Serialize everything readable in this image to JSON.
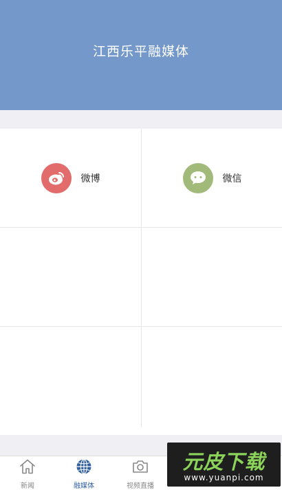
{
  "header": {
    "title": "江西乐平融媒体"
  },
  "share": {
    "items": [
      {
        "label": "微博",
        "icon": "weibo-icon",
        "color": "#e26b6b"
      },
      {
        "label": "微信",
        "icon": "wechat-icon",
        "color": "#a1ba7a"
      }
    ]
  },
  "tabbar": {
    "active_color": "#2f5f9e",
    "items": [
      {
        "label": "新闻",
        "icon": "home-icon"
      },
      {
        "label": "融媒体",
        "icon": "globe-icon",
        "active": true
      },
      {
        "label": "视频直播",
        "icon": "camera-icon"
      }
    ]
  },
  "watermark": {
    "main": "元皮下载",
    "sub": "www.yuanpi.com"
  }
}
